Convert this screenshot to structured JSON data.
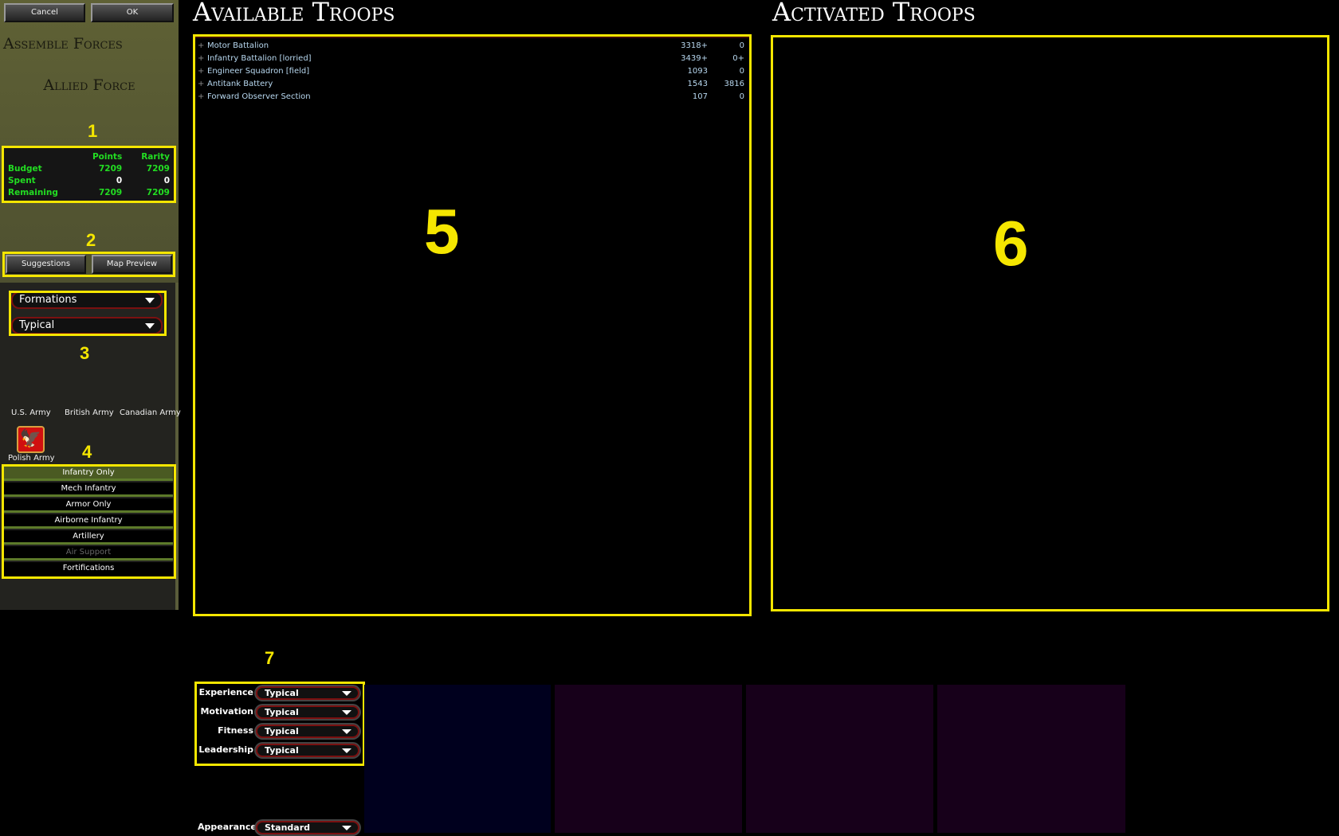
{
  "sidebar": {
    "cancel": "Cancel",
    "ok": "OK",
    "heading": "Assemble Forces",
    "force": "Allied Force",
    "stats": {
      "headers": [
        "Points",
        "Rarity"
      ],
      "rows": [
        {
          "label": "Budget",
          "points": "7209",
          "rarity": "7209"
        },
        {
          "label": "Spent",
          "points": "0",
          "rarity": "0"
        },
        {
          "label": "Remaining",
          "points": "7209",
          "rarity": "7209"
        }
      ]
    },
    "suggestions": "Suggestions",
    "map_preview": "Map Preview",
    "filter1": "Formations",
    "filter2": "Typical",
    "armies": [
      "U.S. Army",
      "British Army",
      "Canadian Army",
      "Polish Army"
    ],
    "categories": [
      "Infantry Only",
      "Mech Infantry",
      "Armor Only",
      "Airborne Infantry",
      "Artillery",
      "Air Support",
      "Fortifications"
    ],
    "selected_category": "Infantry Only",
    "disabled_category": "Air Support"
  },
  "available": {
    "title": "Available Troops",
    "items": [
      {
        "name": "Motor Battalion",
        "points": "3318+",
        "rarity": "0"
      },
      {
        "name": "Infantry Battalion [lorried]",
        "points": "3439+",
        "rarity": "0+"
      },
      {
        "name": "Engineer Squadron [field]",
        "points": "1093",
        "rarity": "0"
      },
      {
        "name": "Antitank Battery",
        "points": "1543",
        "rarity": "3816"
      },
      {
        "name": "Forward Observer Section",
        "points": "107",
        "rarity": "0"
      }
    ]
  },
  "activated": {
    "title": "Activated Troops"
  },
  "attributes": [
    {
      "label": "Experience",
      "value": "Typical"
    },
    {
      "label": "Motivation",
      "value": "Typical"
    },
    {
      "label": "Fitness",
      "value": "Typical"
    },
    {
      "label": "Leadership",
      "value": "Typical"
    }
  ],
  "appearance": {
    "label": "Appearance",
    "value": "Standard"
  },
  "annotations": [
    "1",
    "2",
    "3",
    "4",
    "5",
    "6",
    "7"
  ],
  "colors": {
    "highlight": "#f5e600",
    "stat_green": "#22dd22",
    "selected_category": "#4a5a22"
  }
}
